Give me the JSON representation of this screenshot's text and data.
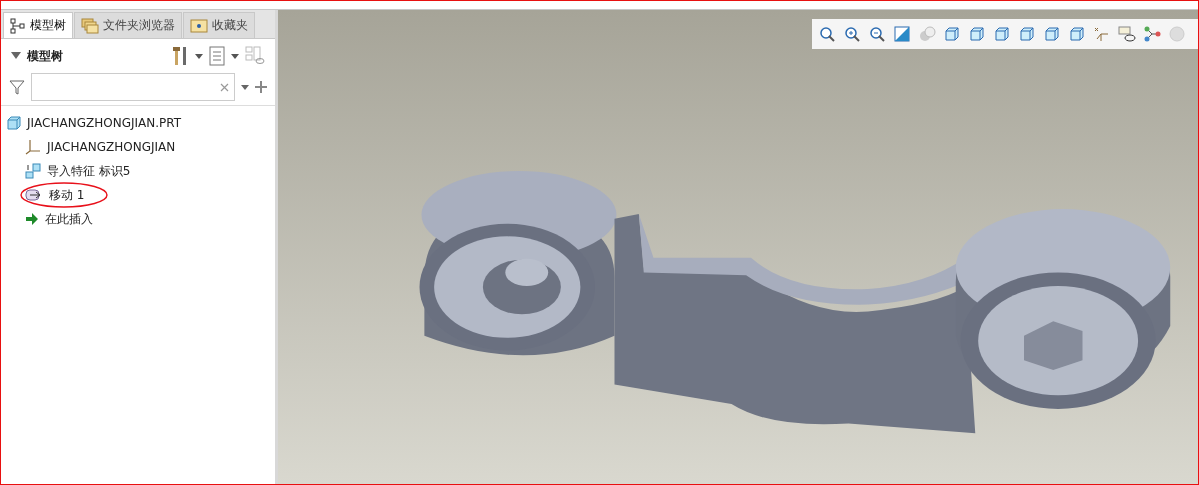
{
  "tabs": [
    {
      "label": "模型树",
      "selected": true
    },
    {
      "label": "文件夹浏览器",
      "selected": false
    },
    {
      "label": "收藏夹",
      "selected": false
    }
  ],
  "tree_header": {
    "title": "模型树",
    "expanded": true
  },
  "tree": [
    {
      "label": "JIACHANGZHONGJIAN.PRT",
      "kind": "part",
      "circled": false,
      "children": [
        {
          "label": "JIACHANGZHONGJIAN",
          "kind": "csys",
          "circled": false
        },
        {
          "label": "导入特征 标识5",
          "kind": "import",
          "circled": false
        },
        {
          "label": "移动 1",
          "kind": "move",
          "circled": true
        },
        {
          "label": "在此插入",
          "kind": "insert",
          "circled": false
        }
      ]
    }
  ]
}
